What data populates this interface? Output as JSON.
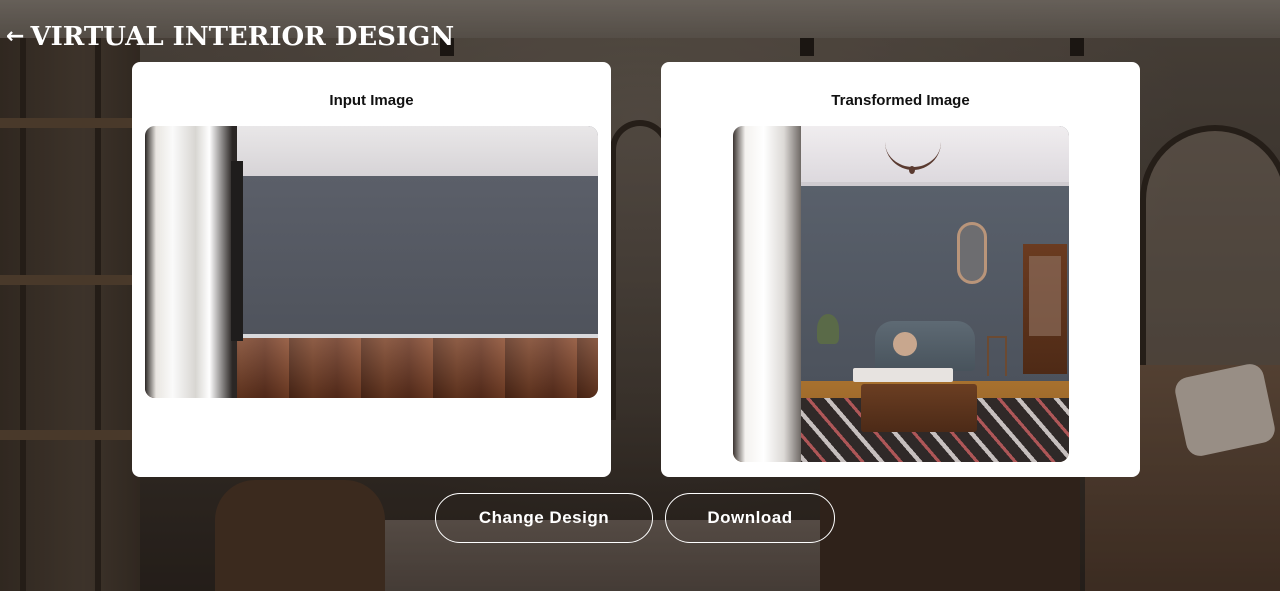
{
  "header": {
    "back_icon": "←",
    "title": "VIRTUAL INTERIOR DESIGN"
  },
  "input_panel": {
    "title": "Input Image",
    "image": "empty room with gray wall and hardwood floor"
  },
  "output_panel": {
    "title": "Transformed Image",
    "image": "furnished living room with sofa, rug and chandelier"
  },
  "actions": {
    "change_design_label": "Change Design",
    "download_label": "Download"
  },
  "colors": {
    "card_background": "#ffffff",
    "button_border": "#ffffff",
    "text_light": "#ffffff",
    "text_dark": "#111111"
  }
}
